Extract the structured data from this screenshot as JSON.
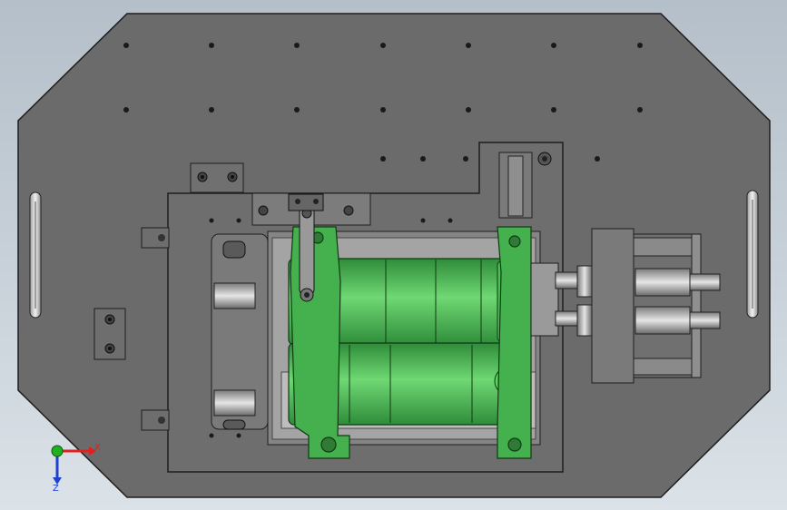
{
  "window": {
    "title": ""
  },
  "viewport": {
    "view_orientation": "top",
    "background_gradient": [
      "#b4bfc9",
      "#dbe2e8"
    ]
  },
  "colors": {
    "plate": "#6b6b6b",
    "plate_edge": "#1e1e1e",
    "sub_plate": "#6e6e6e",
    "fixture": "#8a8a8a",
    "metal_light": "#d9d9d9",
    "motor_green": "#3fa84a",
    "motor_green_light": "#7be07f",
    "hole": "#1a1a1a",
    "axis_x": "#e02020",
    "axis_y": "#20b020",
    "axis_z": "#2040d0"
  },
  "model": {
    "parts": [
      {
        "name": "base-plate",
        "icon": "octagonal-plate"
      },
      {
        "name": "left-handle",
        "icon": "handle-bar"
      },
      {
        "name": "right-handle",
        "icon": "handle-bar"
      },
      {
        "name": "fixture-plate",
        "icon": "sub-plate"
      },
      {
        "name": "upper-motor",
        "icon": "motor-cylinder"
      },
      {
        "name": "lower-motor",
        "icon": "motor-cylinder"
      },
      {
        "name": "cylinder-block",
        "icon": "pneumatic-cylinder"
      }
    ]
  },
  "triad": {
    "x_label": "X",
    "y_label": "Y",
    "z_label": "Z"
  }
}
